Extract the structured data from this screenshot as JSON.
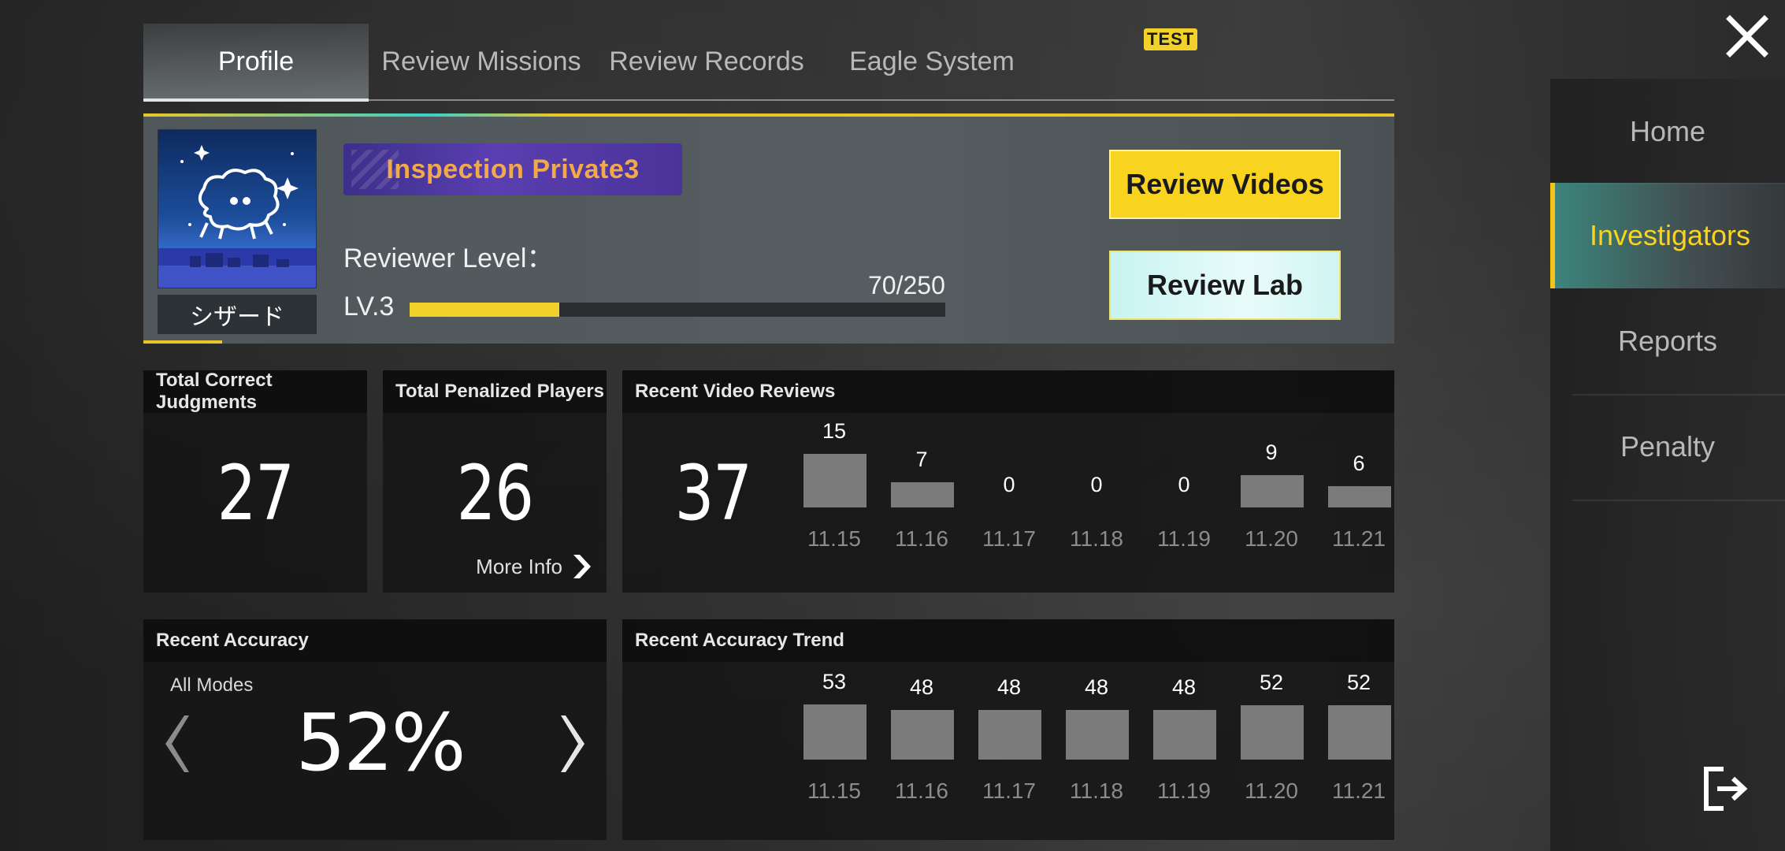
{
  "tabs": [
    {
      "label": "Profile",
      "active": true
    },
    {
      "label": "Review Missions"
    },
    {
      "label": "Review Records"
    },
    {
      "label": "Eagle System",
      "badge": "TEST"
    }
  ],
  "profile": {
    "avatar_name": "シザード",
    "rank": "Inspection Private3",
    "reviewer_level_label": "Reviewer Level：",
    "level": "LV.3",
    "progress_text": "70/250",
    "progress_value": 70,
    "progress_max": 250,
    "review_videos_btn": "Review Videos",
    "review_lab_btn": "Review Lab"
  },
  "stats": {
    "correct": {
      "title": "Total Correct Judgments",
      "value": "27"
    },
    "penalized": {
      "title": "Total Penalized Players",
      "value": "26",
      "more": "More Info"
    },
    "recent_videos": {
      "title": "Recent Video Reviews",
      "total": "37",
      "dates": [
        "11.15",
        "11.16",
        "11.17",
        "11.18",
        "11.19",
        "11.20",
        "11.21"
      ],
      "values": [
        15,
        7,
        0,
        0,
        0,
        9,
        6
      ]
    },
    "accuracy": {
      "title": "Recent Accuracy",
      "mode": "All Modes",
      "value": "52%"
    },
    "accuracy_trend": {
      "title": "Recent Accuracy Trend",
      "dates": [
        "11.15",
        "11.16",
        "11.17",
        "11.18",
        "11.19",
        "11.20",
        "11.21"
      ],
      "values": [
        53,
        48,
        48,
        48,
        48,
        52,
        52
      ]
    }
  },
  "sidebar": {
    "items": [
      {
        "label": "Home"
      },
      {
        "label": "Investigators",
        "active": true
      },
      {
        "label": "Reports"
      },
      {
        "label": "Penalty"
      }
    ]
  },
  "colors": {
    "accent_yellow": "#f8d31f",
    "accent_teal": "#3ad0c8",
    "bar_gray": "#7b7b7b",
    "rank_orange": "#f2a94a"
  }
}
